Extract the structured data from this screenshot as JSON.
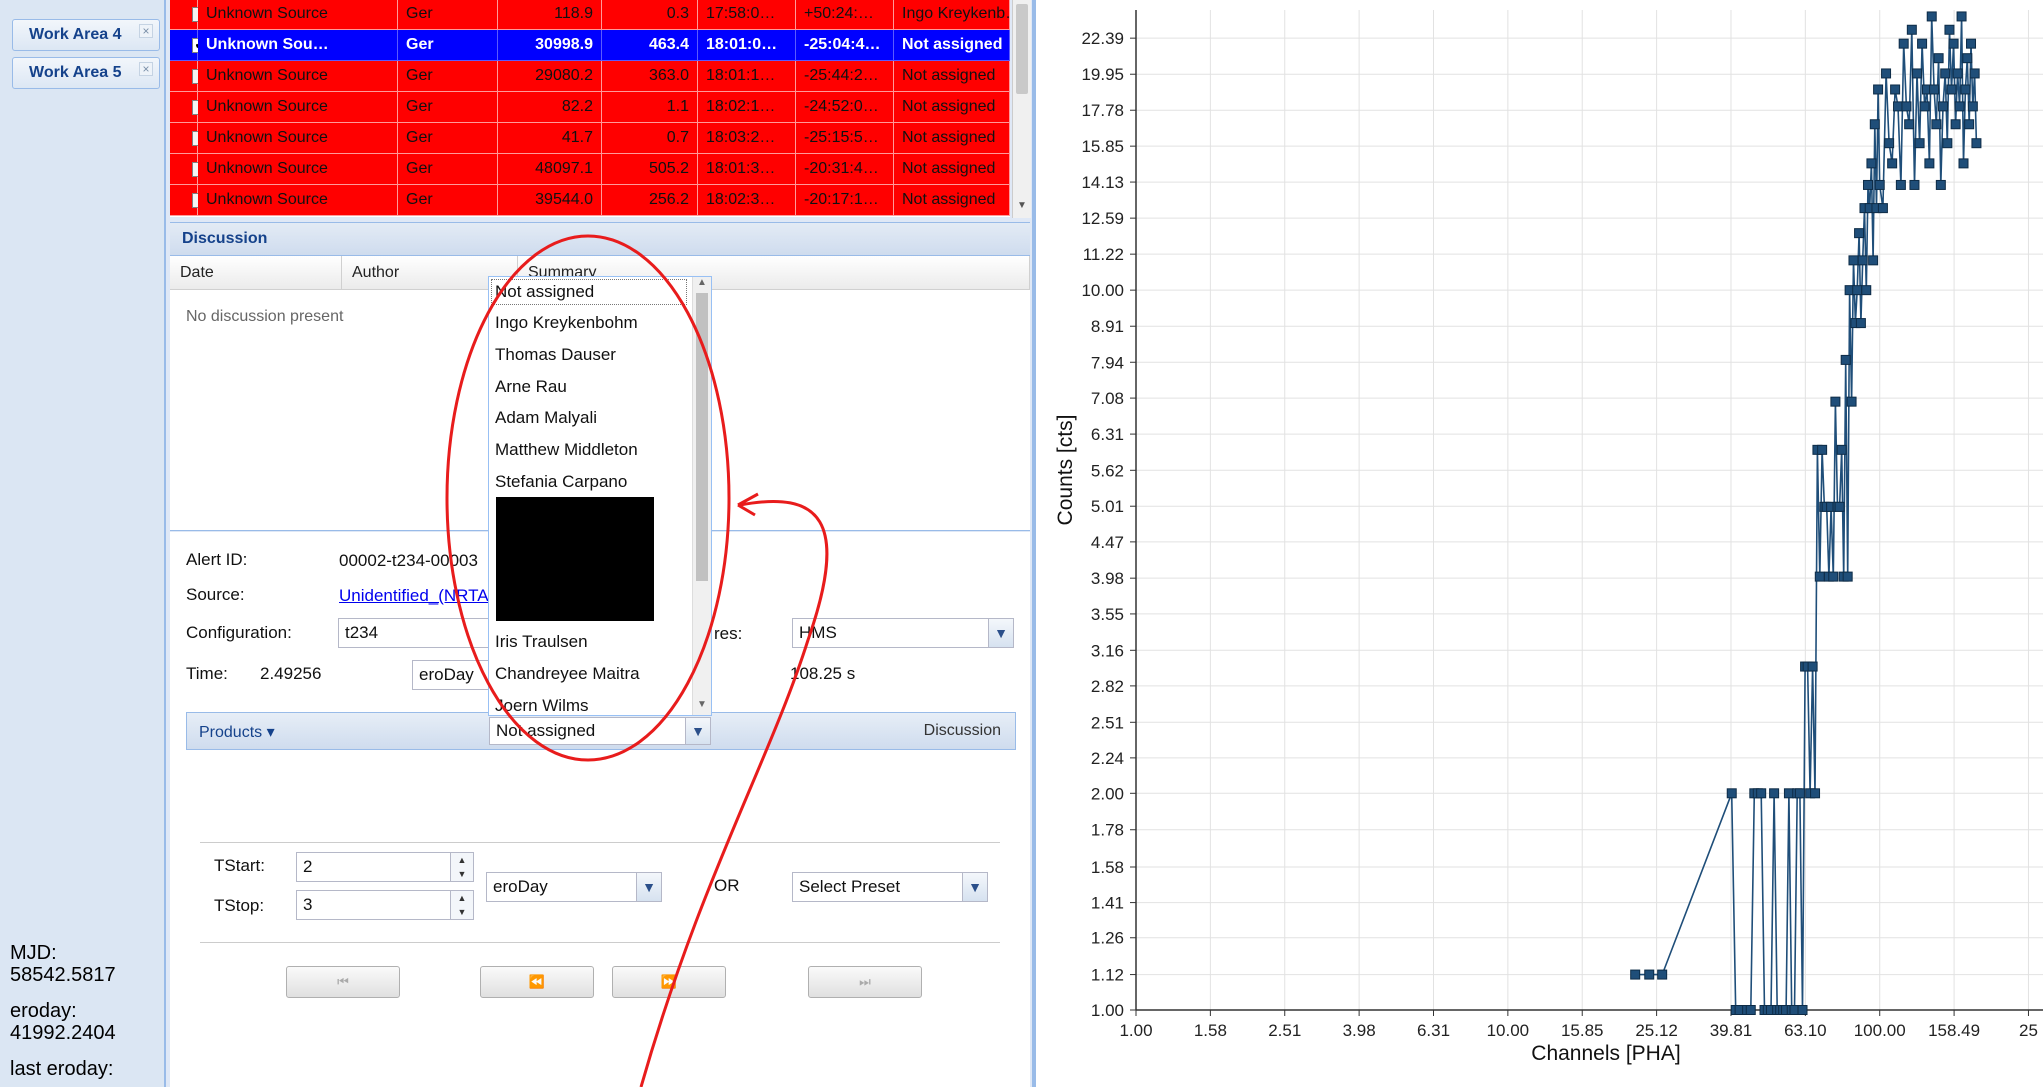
{
  "sidebar": {
    "tabs": [
      {
        "label": "Work Area 4",
        "close": "×"
      },
      {
        "label": "Work Area 5",
        "close": "×"
      }
    ],
    "info": {
      "mjd_label": "MJD:",
      "mjd_value": "58542.5817",
      "eroday_label": "eroday:",
      "eroday_value": "41992.2404",
      "last_eroday_label": "last eroday:"
    }
  },
  "alerts_table": {
    "rows": [
      {
        "checked": false,
        "state": "red",
        "cells": [
          "Unknown Source",
          "Ger",
          "118.9",
          "0.3",
          "17:58:0…",
          "+50:24:…",
          "Ingo Kreykenb…"
        ]
      },
      {
        "checked": true,
        "state": "selected",
        "cells": [
          "Unknown Sou…",
          "Ger",
          "30998.9",
          "463.4",
          "18:01:0…",
          "-25:04:4…",
          "Not assigned"
        ]
      },
      {
        "checked": false,
        "state": "red",
        "cells": [
          "Unknown Source",
          "Ger",
          "29080.2",
          "363.0",
          "18:01:1…",
          "-25:44:2…",
          "Not assigned"
        ]
      },
      {
        "checked": false,
        "state": "red",
        "cells": [
          "Unknown Source",
          "Ger",
          "82.2",
          "1.1",
          "18:02:1…",
          "-24:52:0…",
          "Not assigned"
        ]
      },
      {
        "checked": false,
        "state": "red",
        "cells": [
          "Unknown Source",
          "Ger",
          "41.7",
          "0.7",
          "18:03:2…",
          "-25:15:5…",
          "Not assigned"
        ]
      },
      {
        "checked": false,
        "state": "red",
        "cells": [
          "Unknown Source",
          "Ger",
          "48097.1",
          "505.2",
          "18:01:3…",
          "-20:31:4…",
          "Not assigned"
        ]
      },
      {
        "checked": false,
        "state": "red",
        "cells": [
          "Unknown Source",
          "Ger",
          "39544.0",
          "256.2",
          "18:02:3…",
          "-20:17:1…",
          "Not assigned"
        ]
      }
    ]
  },
  "discussion": {
    "title": "Discussion",
    "columns": [
      "Date",
      "Author",
      "Summary"
    ],
    "empty_text": "No discussion present"
  },
  "details": {
    "alert_id_label": "Alert ID:",
    "alert_id_value": "00002-t234-00003",
    "source_label": "Source:",
    "source_value": "Unidentified_(NRTA",
    "configuration_label": "Configuration:",
    "configuration_value": "t234",
    "res_label": "res:",
    "res_value": "HMS",
    "time_label": "Time:",
    "time_value": "2.49256",
    "time_unit": "eroDay",
    "duration_value": "108.25 s",
    "products_label": "Products ▾",
    "assign_value": "Not assigned",
    "discussion_link": "Discussion",
    "tstart_label": "TStart:",
    "tstart_value": "2",
    "tstop_label": "TStop:",
    "tstop_value": "3",
    "range_unit": "eroDay",
    "or_label": "OR",
    "preset_value": "Select Preset",
    "nav_first": "⏮",
    "nav_prev": "⏪",
    "nav_next": "⏩",
    "nav_last": "⏭"
  },
  "assign_dropdown": {
    "options": [
      "Not assigned",
      "Ingo Kreykenbohm",
      "Thomas Dauser",
      "Arne Rau",
      "Adam Malyali",
      "Matthew Middleton",
      "Stefania Carpano",
      "Iris Traulsen",
      "Chandreyee Maitra",
      "Joern Wilms"
    ],
    "selected": "Not assigned"
  },
  "chart_data": {
    "type": "line",
    "xlabel": "Channels [PHA]",
    "ylabel": "Counts [cts]",
    "x_scale": "log",
    "y_scale": "log",
    "xlim": [
      1.0,
      280
    ],
    "ylim": [
      1.0,
      24.5
    ],
    "x_ticks": [
      "1.00",
      "1.58",
      "2.51",
      "3.98",
      "6.31",
      "10.00",
      "15.85",
      "25.12",
      "39.81",
      "63.10",
      "100.00",
      "158.49",
      "25"
    ],
    "y_ticks": [
      "22.39",
      "19.95",
      "17.78",
      "15.85",
      "14.13",
      "12.59",
      "11.22",
      "10.00",
      "8.91",
      "7.94",
      "7.08",
      "6.31",
      "5.62",
      "5.01",
      "4.47",
      "3.98",
      "3.55",
      "3.16",
      "2.82",
      "2.51",
      "2.24",
      "2.00",
      "1.78",
      "1.58",
      "1.41",
      "1.26",
      "1.12",
      "1.00"
    ],
    "grid": true,
    "series": [
      {
        "color": "#1f4e79",
        "x": [
          22,
          24,
          26,
          40,
          41,
          42,
          44,
          45,
          46,
          47,
          48,
          49,
          50,
          51,
          52,
          53,
          54,
          55,
          56,
          57,
          58,
          59,
          60,
          61,
          62,
          63,
          64,
          65,
          66,
          67,
          68,
          69,
          70,
          71,
          72,
          73,
          74,
          75,
          76,
          77,
          78,
          79,
          80,
          81,
          82,
          83,
          84,
          85,
          86,
          87,
          88,
          89,
          90,
          91,
          92,
          93,
          94,
          95,
          96,
          97,
          98,
          99,
          100,
          102,
          104,
          106,
          108,
          110,
          112,
          114,
          116,
          118,
          120,
          122,
          124,
          126,
          128,
          130,
          132,
          134,
          136,
          138,
          140,
          142,
          144,
          146,
          148,
          150,
          152,
          154,
          156,
          158,
          160,
          162,
          164,
          166,
          168,
          170,
          172,
          174,
          176,
          178,
          180,
          182
        ],
        "y": [
          1.12,
          1.12,
          1.12,
          2,
          1,
          1,
          1,
          1,
          2,
          2,
          2,
          1,
          1,
          1,
          2,
          1,
          1,
          1,
          1,
          2,
          1,
          1,
          2,
          2,
          1,
          3,
          3,
          2,
          3,
          2,
          6,
          4,
          6,
          5,
          5,
          4,
          5,
          4,
          7,
          5,
          5,
          6,
          4,
          8,
          4,
          10,
          7,
          11,
          9,
          10,
          12,
          9,
          11,
          13,
          10,
          14,
          13,
          15,
          11,
          17,
          13,
          19,
          14,
          13,
          20,
          16,
          15,
          19,
          18,
          14,
          22,
          18,
          17,
          23,
          14,
          20,
          16,
          22,
          18,
          19,
          15,
          24,
          19,
          17,
          21,
          14,
          18,
          20,
          16,
          23,
          19,
          22,
          17,
          20,
          18,
          24,
          15,
          19,
          21,
          17,
          22,
          18,
          20,
          16
        ]
      }
    ]
  }
}
